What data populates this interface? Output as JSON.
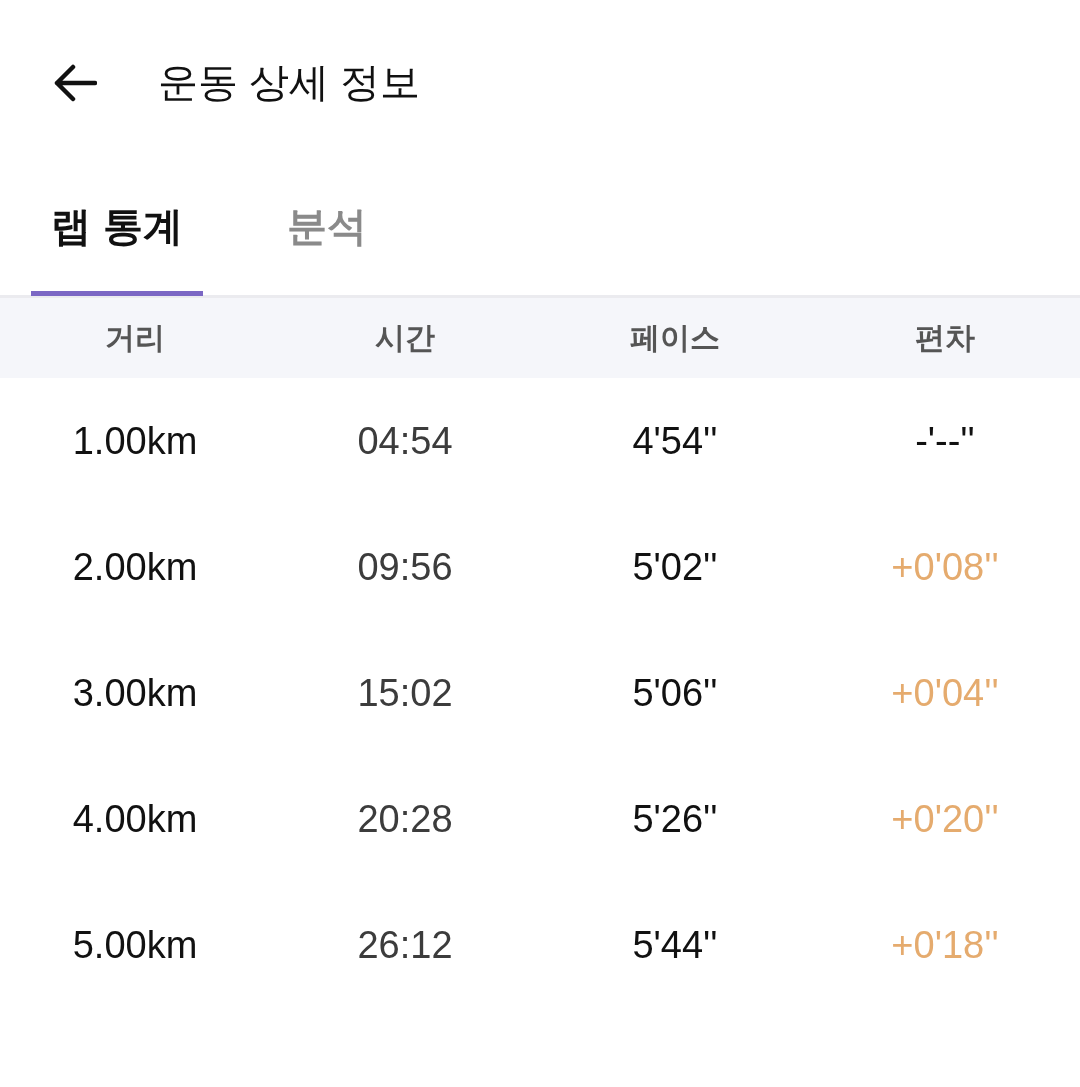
{
  "header": {
    "title": "운동 상세 정보"
  },
  "tabs": [
    {
      "label": "랩 통계",
      "selected": true
    },
    {
      "label": "분석",
      "selected": false
    }
  ],
  "table": {
    "columns": [
      "거리",
      "시간",
      "페이스",
      "편차"
    ],
    "rows": [
      {
        "distance": "1.00km",
        "time": "04:54",
        "pace": "4'54''",
        "deviation": "-'--''",
        "kind": "baseline"
      },
      {
        "distance": "2.00km",
        "time": "09:56",
        "pace": "5'02''",
        "deviation": "+0'08''",
        "kind": "slower"
      },
      {
        "distance": "3.00km",
        "time": "15:02",
        "pace": "5'06''",
        "deviation": "+0'04''",
        "kind": "slower"
      },
      {
        "distance": "4.00km",
        "time": "20:28",
        "pace": "5'26''",
        "deviation": "+0'20''",
        "kind": "slower"
      },
      {
        "distance": "5.00km",
        "time": "26:12",
        "pace": "5'44''",
        "deviation": "+0'18''",
        "kind": "slower"
      }
    ]
  }
}
